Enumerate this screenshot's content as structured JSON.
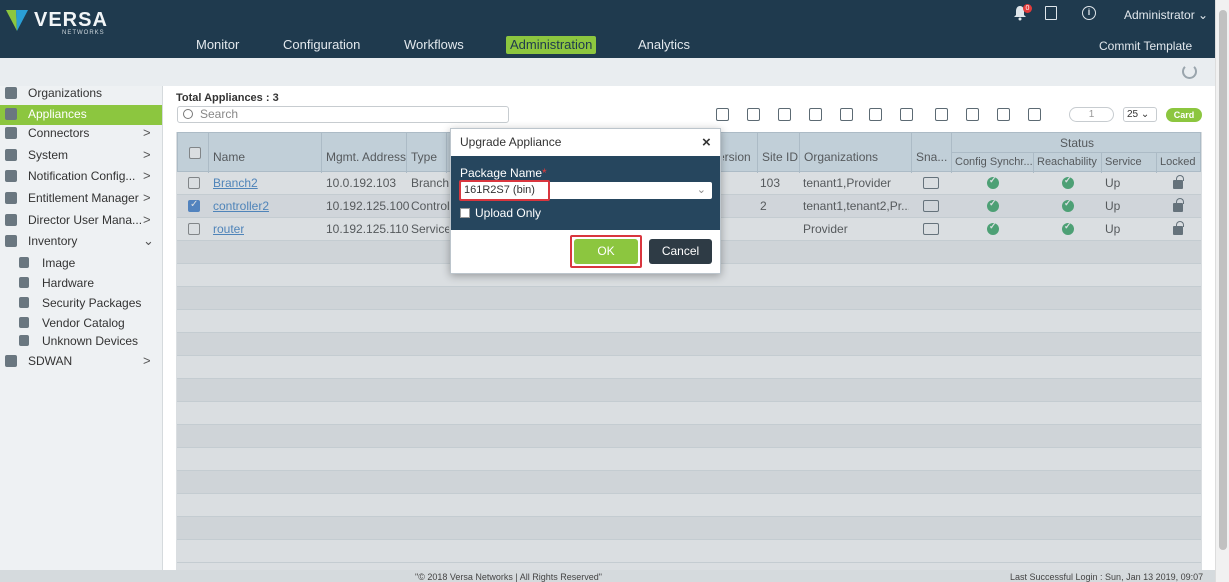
{
  "header": {
    "logo_text": "VERSA",
    "logo_sub": "NETWORKS",
    "nav": [
      "Monitor",
      "Configuration",
      "Workflows",
      "Administration",
      "Analytics"
    ],
    "active_nav": "Administration",
    "notification_count": "0",
    "user": "Administrator ⌄",
    "commit": "Commit Template",
    "accent_color": "#8cc63f",
    "bg_color": "#1f3a4e"
  },
  "sidebar": {
    "items": [
      {
        "label": "Organizations",
        "chev": ""
      },
      {
        "label": "Appliances",
        "chev": ""
      },
      {
        "label": "Connectors",
        "chev": ">"
      },
      {
        "label": "System",
        "chev": ">"
      },
      {
        "label": "Notification Config...",
        "chev": ">"
      },
      {
        "label": "Entitlement Manager",
        "chev": ">"
      },
      {
        "label": "Director User Mana...",
        "chev": ">"
      },
      {
        "label": "Inventory",
        "chev": "⌄"
      },
      {
        "label": "Image",
        "chev": ""
      },
      {
        "label": "Hardware",
        "chev": ""
      },
      {
        "label": "Security Packages",
        "chev": ""
      },
      {
        "label": "Vendor Catalog",
        "chev": ""
      },
      {
        "label": "Unknown Devices",
        "chev": ""
      },
      {
        "label": "SDWAN",
        "chev": ">"
      }
    ]
  },
  "main": {
    "total": "Total Appliances : 3",
    "search_placeholder": "Search",
    "page": "1",
    "page_size": "25 ⌄",
    "card_label": "Card",
    "columns": {
      "name": "Name",
      "mgmt": "Mgmt. Address",
      "type": "Type",
      "version": "ersion",
      "site": "Site ID",
      "orgs": "Organizations",
      "snap": "Sna...",
      "status": "Status",
      "config": "Config Synchr...",
      "reach": "Reachability",
      "service": "Service",
      "locked": "Locked"
    },
    "rows": [
      {
        "name": "Branch2",
        "mgmt": "10.0.192.103",
        "type": "Branch",
        "site": "103",
        "orgs": "tenant1,Provider",
        "service": "Up",
        "checked": false
      },
      {
        "name": "controller2",
        "mgmt": "10.192.125.100",
        "type": "Controll",
        "site": "2",
        "orgs": "tenant1,tenant2,Pr...",
        "service": "Up",
        "checked": true
      },
      {
        "name": "router",
        "mgmt": "10.192.125.110",
        "type": "Service-",
        "site": "",
        "orgs": "Provider",
        "service": "Up",
        "checked": false
      }
    ]
  },
  "modal": {
    "title": "Upgrade Appliance",
    "close": "×",
    "package_label": "Package Name",
    "required_mark": "*",
    "package_value": "161R2S7 (bin)",
    "upload_only": "Upload Only",
    "ok": "OK",
    "cancel": "Cancel"
  },
  "footer": {
    "copyright": "\"© 2018 Versa Networks | All Rights Reserved\"",
    "last_login": "Last Successful Login : Sun, Jan 13 2019, 09:07"
  }
}
